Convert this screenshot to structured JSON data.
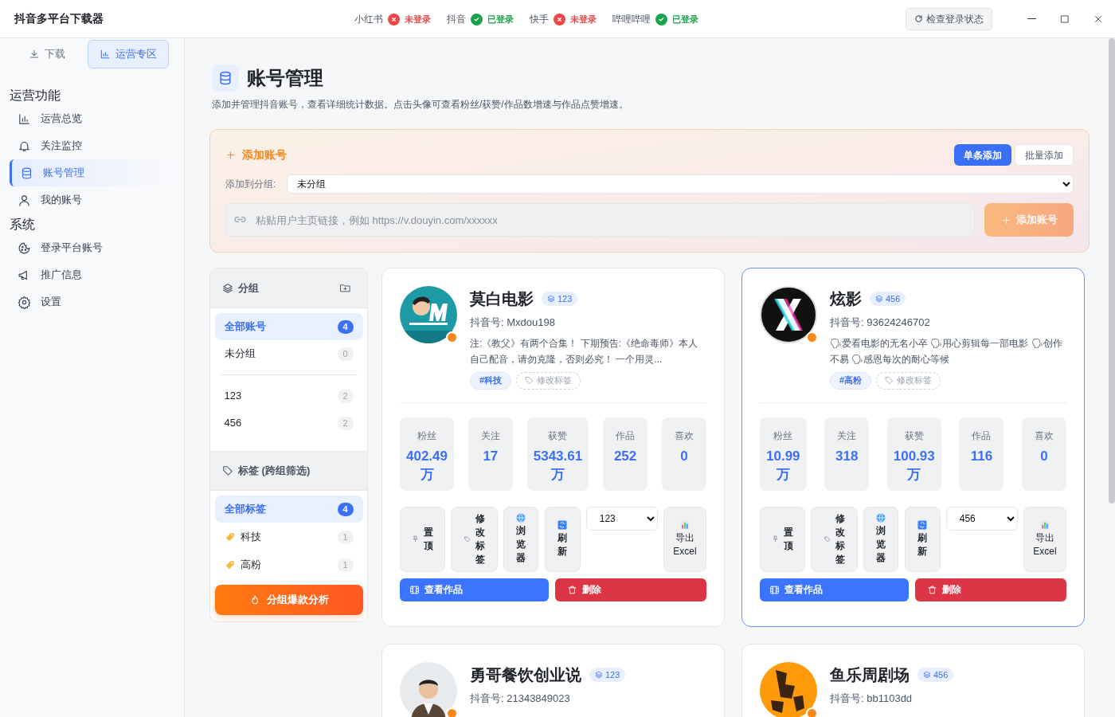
{
  "window": {
    "title": "抖音多平台下载器",
    "check_button": "检查登录状态"
  },
  "platforms": [
    {
      "name": "小红书",
      "logged_in": false,
      "status": "未登录"
    },
    {
      "name": "抖音",
      "logged_in": true,
      "status": "已登录"
    },
    {
      "name": "快手",
      "logged_in": false,
      "status": "未登录"
    },
    {
      "name": "哔哩哔哩",
      "logged_in": true,
      "status": "已登录"
    }
  ],
  "sidebar": {
    "tabs": [
      {
        "label": "下载",
        "selected": false
      },
      {
        "label": "运营专区",
        "selected": true
      }
    ],
    "sections": [
      {
        "title": "运营功能",
        "items": [
          {
            "label": "运营总览",
            "selected": false
          },
          {
            "label": "关注监控",
            "selected": false
          },
          {
            "label": "账号管理",
            "selected": true
          },
          {
            "label": "我的账号",
            "selected": false
          }
        ]
      },
      {
        "title": "系统",
        "items": [
          {
            "label": "登录平台账号",
            "selected": false
          },
          {
            "label": "推广信息",
            "selected": false
          },
          {
            "label": "设置",
            "selected": false
          }
        ]
      }
    ]
  },
  "page": {
    "title": "账号管理",
    "description": "添加并管理抖音账号，查看详细统计数据。点击头像可查看粉丝/获赞/作品数增速与作品点赞增速。"
  },
  "add_panel": {
    "title": "添加账号",
    "modes": [
      {
        "label": "单条添加",
        "selected": true
      },
      {
        "label": "批量添加",
        "selected": false
      }
    ],
    "group_label": "添加到分组:",
    "group_value": "未分组",
    "placeholder": "粘贴用户主页链接，例如 https://v.douyin.com/xxxxxx",
    "submit": "添加账号",
    "submit_disabled": true
  },
  "groups_panel": {
    "title": "分组",
    "groups": [
      {
        "label": "全部账号",
        "count": "4",
        "selected": true
      },
      {
        "label": "未分组",
        "count": "0",
        "selected": false
      },
      {
        "label": "123",
        "count": "2",
        "selected": false
      },
      {
        "label": "456",
        "count": "2",
        "selected": false
      }
    ],
    "tags_title": "标签 (跨组筛选)",
    "tags": [
      {
        "label": "全部标签",
        "count": "4",
        "selected": true
      },
      {
        "label": "科技",
        "count": "1",
        "selected": false
      },
      {
        "label": "高粉",
        "count": "1",
        "selected": false
      }
    ],
    "analyze_button": "分组爆款分析"
  },
  "accounts": [
    {
      "name": "莫白电影",
      "group": "123",
      "douyin_id": "抖音号: Mxdou198",
      "selected": false,
      "description": "注:《教父》有两个合集！ 下期预告:《绝命毒师》本人自己配音，请勿克隆，否则必究！ 一个用灵...",
      "tags": [
        "#科技"
      ],
      "edit_tags": "修改标签",
      "stats": [
        {
          "label": "粉丝",
          "value": "402.49",
          "unit": "万"
        },
        {
          "label": "关注",
          "value": "17"
        },
        {
          "label": "获赞",
          "value": "5343.61",
          "unit": "万"
        },
        {
          "label": "作品",
          "value": "252"
        },
        {
          "label": "喜欢",
          "value": "0"
        }
      ],
      "actions": [
        {
          "kind": "pin",
          "label": "置顶"
        },
        {
          "kind": "tag",
          "label": "修改标签"
        },
        {
          "kind": "browser",
          "label": "浏览器"
        },
        {
          "kind": "refresh",
          "label": "刷新"
        },
        {
          "kind": "select",
          "value": "123"
        },
        {
          "kind": "export",
          "label": "导出 Excel"
        }
      ],
      "buttons": [
        {
          "kind": "view",
          "label": "查看作品"
        },
        {
          "kind": "delete",
          "label": "删除"
        }
      ]
    },
    {
      "name": "炫影",
      "group": "456",
      "douyin_id": "抖音号: 93624246702",
      "selected": true,
      "description": "🗣爱看电影的无名小卒 🗣用心剪辑每一部电影 🗣创作不易 🗣感恩每次的耐心等候",
      "tags": [
        "#高粉"
      ],
      "edit_tags": "修改标签",
      "stats": [
        {
          "label": "粉丝",
          "value": "10.99",
          "unit": "万"
        },
        {
          "label": "关注",
          "value": "318"
        },
        {
          "label": "获赞",
          "value": "100.93",
          "unit": "万"
        },
        {
          "label": "作品",
          "value": "116"
        },
        {
          "label": "喜欢",
          "value": "0"
        }
      ],
      "actions": [
        {
          "kind": "pin",
          "label": "置顶"
        },
        {
          "kind": "tag",
          "label": "修改标签"
        },
        {
          "kind": "browser",
          "label": "浏览器"
        },
        {
          "kind": "refresh",
          "label": "刷新"
        },
        {
          "kind": "select",
          "value": "456"
        },
        {
          "kind": "export",
          "label": "导出 Excel"
        }
      ],
      "buttons": [
        {
          "kind": "view",
          "label": "查看作品"
        },
        {
          "kind": "delete",
          "label": "删除"
        }
      ]
    },
    {
      "name": "勇哥餐饮创业说",
      "group": "123",
      "douyin_id": "抖音号: 21343849023",
      "selected": false
    },
    {
      "name": "鱼乐周剧场",
      "group": "456",
      "douyin_id": "抖音号: bb1103dd",
      "selected": false
    }
  ]
}
